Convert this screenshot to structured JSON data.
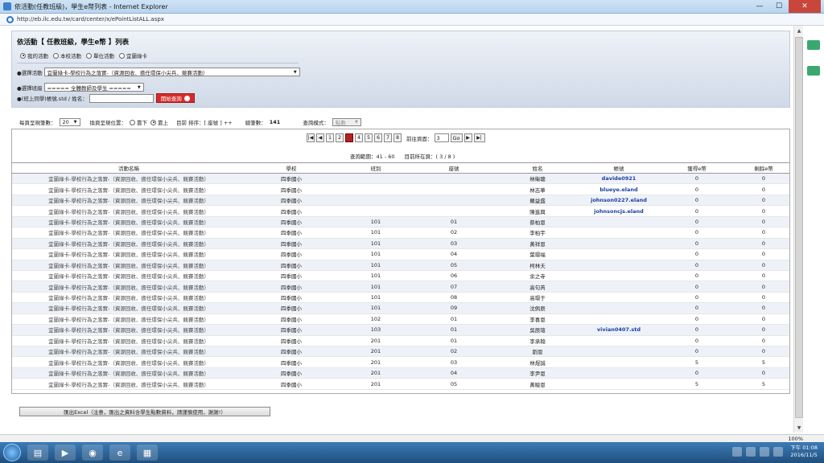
{
  "window": {
    "title": "依活動(任教班級)，學生e幣列表 - Internet Explorer",
    "url": "http://eb.ilc.edu.tw/card/center/x/ePointListALL.aspx",
    "min": "—",
    "max": "☐",
    "close": "✕"
  },
  "page": {
    "heading": "依活動【 任教班級，學生e幣 】列表",
    "radios": [
      {
        "label": "我的活動",
        "checked": true
      },
      {
        "label": "本校活動",
        "checked": false
      },
      {
        "label": "單位活動",
        "checked": false
      },
      {
        "label": "宜蘭綠卡",
        "checked": false
      }
    ],
    "activity_label": "●選擇活動",
    "activity_value": "宜蘭綠卡-學校行為之落實-（資源回收、擔任環保小尖兵、競賽活動）",
    "class_label": "●選擇班級",
    "class_value": "===== 全體教師及學生 =====",
    "account_label": "●(班上同學)帳號.std / 姓名：",
    "account_value": "",
    "search_button": "開始查詢"
  },
  "options": {
    "page_size_label": "每頁呈現筆數：",
    "page_size": "20",
    "pager_pos_label": "換頁呈現位置：",
    "pos_bottom": "靠下",
    "pos_top": "靠上",
    "sort_label": "目前 排序：[ 座號 ] ++",
    "total_label": "總筆數：",
    "total": "141",
    "mode_label": "查詢模式：",
    "mode_value": "點數"
  },
  "pager": {
    "first": "|◀",
    "prev": "◀",
    "pages": [
      "1",
      "2",
      "3",
      "4",
      "5",
      "6",
      "7",
      "8"
    ],
    "current_page": 3,
    "next": "▶",
    "last": "▶|",
    "goto_label": "前往頁面：",
    "goto_value": "3",
    "go": "Go",
    "range": "查詢範圍：41 - 60",
    "position": "目前所在頁：( 3 / 8 )"
  },
  "table": {
    "columns": [
      "活動名稱",
      "學校",
      "班別",
      "座號",
      "姓名",
      "帳號",
      "獲得e幣",
      "剩餘e幣"
    ],
    "rows": [
      [
        "宜蘭綠卡-學校行為之落實-（資源回收、擔任環保小尖兵、競賽活動）",
        "四季國小",
        "",
        "",
        "林衛聰",
        "davide0921",
        "0",
        "0"
      ],
      [
        "宜蘭綠卡-學校行為之落實-（資源回收、擔任環保小尖兵、競賽活動）",
        "四季國小",
        "",
        "",
        "林志華",
        "blueye.eland",
        "0",
        "0"
      ],
      [
        "宜蘭綠卡-學校行為之落實-（資源回收、擔任環保小尖兵、競賽活動）",
        "四季國小",
        "",
        "",
        "羅益盛",
        "johnson0227.eland",
        "0",
        "0"
      ],
      [
        "宜蘭綠卡-學校行為之落實-（資源回收、擔任環保小尖兵、競賽活動）",
        "四季國小",
        "",
        "",
        "陳進興",
        "johnsoncjs.eland",
        "0",
        "0"
      ],
      [
        "宜蘭綠卡-學校行為之落實-（資源回收、擔任環保小尖兵、競賽活動）",
        "四季國小",
        "101",
        "01",
        "蔡柏恩",
        "",
        "0",
        "0"
      ],
      [
        "宜蘭綠卡-學校行為之落實-（資源回收、擔任環保小尖兵、競賽活動）",
        "四季國小",
        "101",
        "02",
        "李柏宇",
        "",
        "0",
        "0"
      ],
      [
        "宜蘭綠卡-學校行為之落實-（資源回收、擔任環保小尖兵、競賽活動）",
        "四季國小",
        "101",
        "03",
        "黃祥恩",
        "",
        "0",
        "0"
      ],
      [
        "宜蘭綠卡-學校行為之落實-（資源回收、擔任環保小尖兵、競賽活動）",
        "四季國小",
        "101",
        "04",
        "葉璟福",
        "",
        "0",
        "0"
      ],
      [
        "宜蘭綠卡-學校行為之落實-（資源回收、擔任環保小尖兵、競賽活動）",
        "四季國小",
        "101",
        "05",
        "柯林夭",
        "",
        "0",
        "0"
      ],
      [
        "宜蘭綠卡-學校行為之落實-（資源回收、擔任環保小尖兵、競賽活動）",
        "四季國小",
        "101",
        "06",
        "余之寺",
        "",
        "0",
        "0"
      ],
      [
        "宜蘭綠卡-學校行為之落實-（資源回收、擔任環保小尖兵、競賽活動）",
        "四季國小",
        "101",
        "07",
        "高句芮",
        "",
        "0",
        "0"
      ],
      [
        "宜蘭綠卡-學校行為之落實-（資源回收、擔任環保小尖兵、競賽活動）",
        "四季國小",
        "101",
        "08",
        "高璟于",
        "",
        "0",
        "0"
      ],
      [
        "宜蘭綠卡-學校行為之落實-（資源回收、擔任環保小尖兵、競賽活動）",
        "四季國小",
        "101",
        "09",
        "沈佩辰",
        "",
        "0",
        "0"
      ],
      [
        "宜蘭綠卡-學校行為之落實-（資源回收、擔任環保小尖兵、競賽活動）",
        "四季國小",
        "102",
        "01",
        "李喜恩",
        "",
        "0",
        "0"
      ],
      [
        "宜蘭綠卡-學校行為之落實-（資源回收、擔任環保小尖兵、競賽活動）",
        "四季國小",
        "103",
        "01",
        "吳辰瑄",
        "vivian0407.std",
        "0",
        "0"
      ],
      [
        "宜蘭綠卡-學校行為之落實-（資源回收、擔任環保小尖兵、競賽活動）",
        "四季國小",
        "201",
        "01",
        "李承翰",
        "",
        "0",
        "0"
      ],
      [
        "宜蘭綠卡-學校行為之落實-（資源回收、擔任環保小尖兵、競賽活動）",
        "四季國小",
        "201",
        "02",
        "劉恩",
        "",
        "0",
        "0"
      ],
      [
        "宜蘭綠卡-學校行為之落實-（資源回收、擔任環保小尖兵、競賽活動）",
        "四季國小",
        "201",
        "03",
        "林煜誠",
        "",
        "5",
        "5"
      ],
      [
        "宜蘭綠卡-學校行為之落實-（資源回收、擔任環保小尖兵、競賽活動）",
        "四季國小",
        "201",
        "04",
        "李尹恩",
        "",
        "0",
        "0"
      ],
      [
        "宜蘭綠卡-學校行為之落實-（資源回收、擔任環保小尖兵、競賽活動）",
        "四季國小",
        "201",
        "05",
        "黃駿恩",
        "",
        "5",
        "5"
      ]
    ]
  },
  "export_button": "匯出Excel（注意，匯出之資料含學生點數資料，請謹慎使用，謝謝!）",
  "status": {
    "zoom": "100%"
  },
  "taskbar": {
    "time": "下午 01:08",
    "date": "2016/11/5"
  }
}
